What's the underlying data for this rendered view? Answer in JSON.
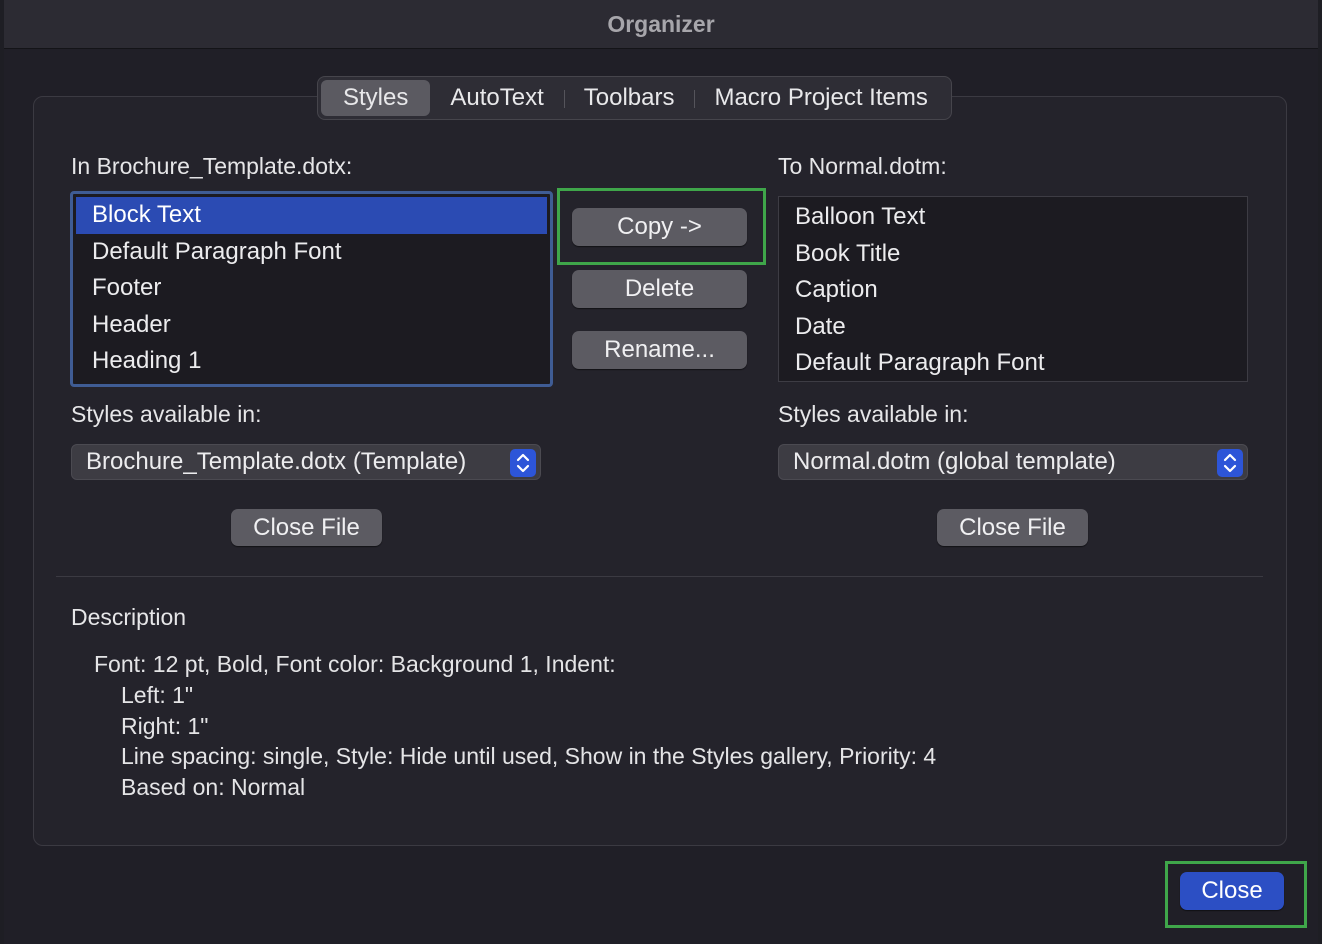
{
  "window": {
    "title": "Organizer"
  },
  "tabs": [
    {
      "label": "Styles",
      "active": true
    },
    {
      "label": "AutoText",
      "active": false
    },
    {
      "label": "Toolbars",
      "active": false
    },
    {
      "label": "Macro Project Items",
      "active": false
    }
  ],
  "left": {
    "heading": "In Brochure_Template.dotx:",
    "items": [
      "Block Text",
      "Default Paragraph Font",
      "Footer",
      "Header",
      "Heading 1"
    ],
    "selected_item": "Block Text",
    "available_label": "Styles available in:",
    "available_value": "Brochure_Template.dotx (Template)",
    "close_file_label": "Close File"
  },
  "right": {
    "heading": "To Normal.dotm:",
    "items": [
      "Balloon Text",
      "Book Title",
      "Caption",
      "Date",
      "Default Paragraph Font"
    ],
    "available_label": "Styles available in:",
    "available_value": "Normal.dotm (global template)",
    "close_file_label": "Close File"
  },
  "actions": {
    "copy_label": "Copy ->",
    "delete_label": "Delete",
    "rename_label": "Rename..."
  },
  "description": {
    "heading": "Description",
    "lines": [
      "Font: 12 pt, Bold, Font color: Background 1, Indent:",
      "Left:  1\"",
      "Right:  1\"",
      "Line spacing:  single, Style: Hide until used, Show in the Styles gallery, Priority: 4",
      "Based on: Normal"
    ]
  },
  "footer": {
    "close_label": "Close"
  },
  "colors": {
    "accent": "#2c4fc4",
    "selection": "#2b4bb3",
    "highlight_box": "#3fa64a",
    "focus_ring": "#3f5c94"
  }
}
